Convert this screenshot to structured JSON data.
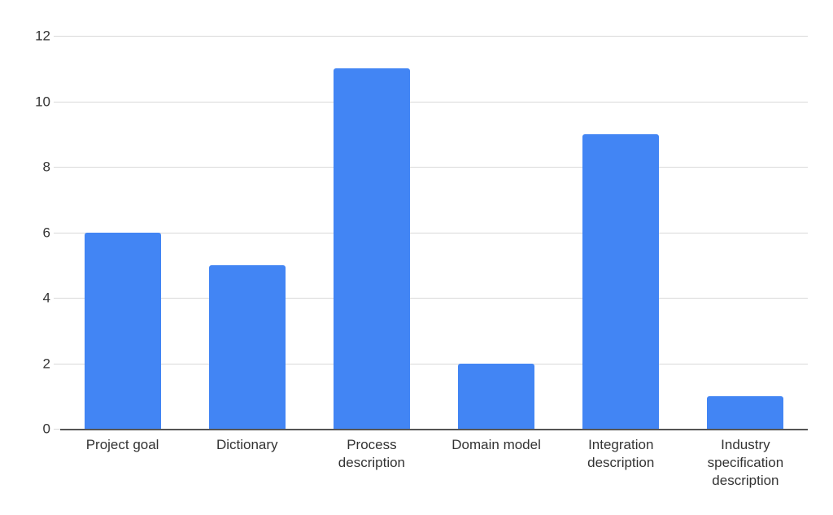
{
  "chart_data": {
    "type": "bar",
    "title": "",
    "subtitle": "",
    "xlabel": "",
    "ylabel": "",
    "categories": [
      "Project goal",
      "Dictionary",
      "Process description",
      "Domain model",
      "Integration description",
      "Industry specification description"
    ],
    "category_lines": [
      [
        "Project goal"
      ],
      [
        "Dictionary"
      ],
      [
        "Process",
        "description"
      ],
      [
        "Domain model"
      ],
      [
        "Integration",
        "description"
      ],
      [
        "Industry",
        "specification",
        "description"
      ]
    ],
    "values": [
      6,
      5,
      11,
      2,
      9,
      1
    ],
    "series": [
      {
        "name": "",
        "values": [
          6,
          5,
          11,
          2,
          9,
          1
        ]
      }
    ],
    "ylim": [
      0,
      12
    ],
    "y_ticks": [
      0,
      2,
      4,
      6,
      8,
      10,
      12
    ],
    "y_tick_labels": [
      "0",
      "2",
      "4",
      "6",
      "8",
      "10",
      "12"
    ],
    "grid": true,
    "legend": false,
    "legend_position": "none",
    "bar_color": "#4285f4",
    "gridline_color": "#d9d9d9",
    "axis_color": "#555555",
    "label_color": "#333333",
    "background_color": "#ffffff"
  }
}
